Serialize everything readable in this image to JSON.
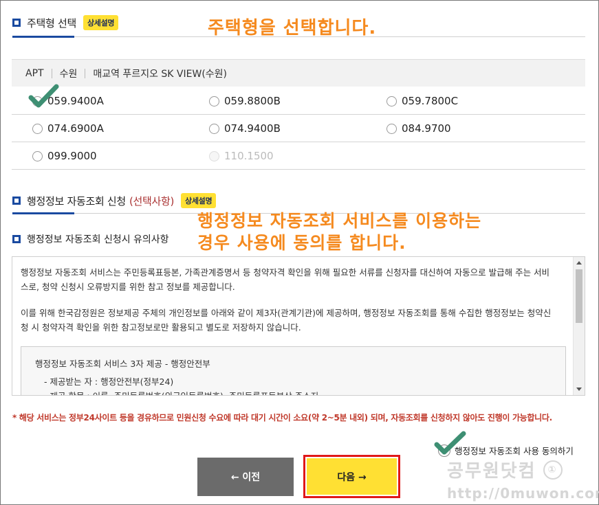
{
  "housing_type_section": {
    "title": "주택형 선택",
    "detail_badge": "상세설명",
    "annotation": "주택형을 선택합니다."
  },
  "breadcrumb": {
    "items": [
      "APT",
      "수원",
      "매교역 푸르지오 SK VIEW(수원)"
    ]
  },
  "housing_options": [
    {
      "label": "059.9400A",
      "selected": true,
      "disabled": false
    },
    {
      "label": "059.8800B",
      "selected": false,
      "disabled": false
    },
    {
      "label": "059.7800C",
      "selected": false,
      "disabled": false
    },
    {
      "label": "074.6900A",
      "selected": false,
      "disabled": false
    },
    {
      "label": "074.9400B",
      "selected": false,
      "disabled": false
    },
    {
      "label": "084.9700",
      "selected": false,
      "disabled": false
    },
    {
      "label": "099.9000",
      "selected": false,
      "disabled": false
    },
    {
      "label": "110.1500",
      "selected": false,
      "disabled": true
    }
  ],
  "admin_section": {
    "title": "행정정보 자동조회 신청",
    "optional": "(선택사항)",
    "detail_badge": "상세설명",
    "annotation_line1": "행정정보 자동조회 서비스를 이용하는",
    "annotation_line2": "경우 사용에 동의를 합니다.",
    "notice_title": "행정정보 자동조회 신청시 유의사항"
  },
  "notice": {
    "para1": "행정정보 자동조회 서비스는 주민등록표등본, 가족관계증명서 등 청약자격 확인을 위해 필요한 서류를 신청자를 대신하여 자동으로 발급해 주는 서비스로, 청약 신청시 오류방지를 위한 참고 정보를 제공합니다.",
    "para2": "이를 위해 한국감정원은 정보제공 주체의 개인정보를 아래와 같이 제3자(관계기관)에 제공하며, 행정정보 자동조회를 통해 수집한 행정정보는 청약신청 시 청약자격 확인을 위한 참고정보로만 활용되고 별도로 저장하지 않습니다.",
    "box_title": "행정정보 자동조회 서비스 3자 제공 - 행정안전부",
    "box_item1": "-   제공받는 자 : 행정안전부(정부24)",
    "box_item2": "-   제공 항목 : 이름, 주민등록번호(외국인등록번호), 주민등록표등본상 주소지"
  },
  "warning": "* 해당 서비스는 정부24사이트 등을 경유하므로 민원신청 수요에 따라 대기 시간이 소요(약 2~5분 내외) 되며, 자동조회를 신청하지 않아도 진행이 가능합니다.",
  "agree_label": "행정정보 자동조회 사용 동의하기",
  "buttons": {
    "prev": "← 이전",
    "next": "다음 →"
  },
  "watermark": {
    "title": "공무원닷컴",
    "circle": "①",
    "url": "http://0muwon.com"
  },
  "colors": {
    "accent_blue": "#1a4aa0",
    "badge_yellow": "#ffe033",
    "annotation_orange": "#f58a1f",
    "warning_red": "#c0392b",
    "check_green": "#3e8f73",
    "highlight_border": "#e01818"
  }
}
